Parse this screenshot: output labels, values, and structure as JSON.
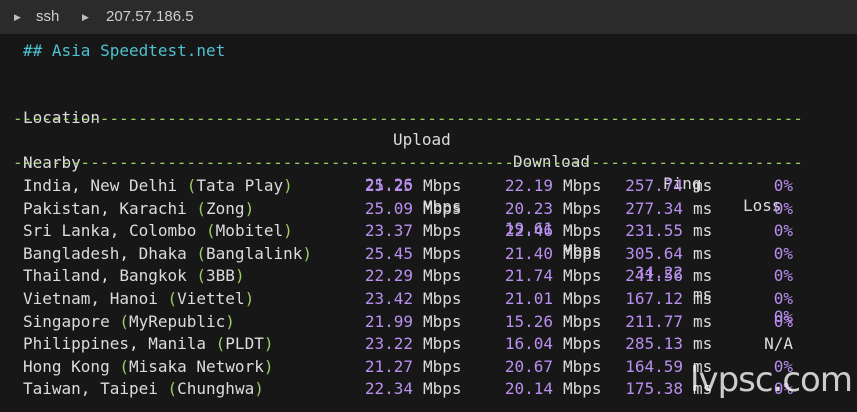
{
  "titlebar": {
    "tab_label": "ssh",
    "host": "207.57.186.5"
  },
  "terminal": {
    "heading": "## Asia Speedtest.net",
    "columns": {
      "location": "Location",
      "upload": "Upload",
      "download": "Download",
      "ping": "Ping",
      "loss": "Loss"
    },
    "separator": "-------------------------------------------------------------------------------------------",
    "nearby": {
      "location": "Nearby",
      "upload": "21.26",
      "download": "19.61",
      "ping": "34.22",
      "loss": "0%"
    },
    "units": {
      "speed": "Mbps",
      "ping": "ms"
    },
    "rows": [
      {
        "city": "India, New Delhi ",
        "open": "(",
        "isp": "Tata Play",
        "close": ")",
        "upload": "25.25",
        "download": "22.19",
        "ping": "257.74",
        "loss": "0%"
      },
      {
        "city": "Pakistan, Karachi ",
        "open": "(",
        "isp": "Zong",
        "close": ")",
        "upload": "25.09",
        "download": "20.23",
        "ping": "277.34",
        "loss": "0%"
      },
      {
        "city": "Sri Lanka, Colombo ",
        "open": "(",
        "isp": "Mobitel",
        "close": ")",
        "upload": "23.37",
        "download": "22.46",
        "ping": "231.55",
        "loss": "0%"
      },
      {
        "city": "Bangladesh, Dhaka ",
        "open": "(",
        "isp": "Banglalink",
        "close": ")",
        "upload": "25.45",
        "download": "21.40",
        "ping": "305.64",
        "loss": "0%"
      },
      {
        "city": "Thailand, Bangkok ",
        "open": "(",
        "isp": "3BB",
        "close": ")",
        "upload": "22.29",
        "download": "21.74",
        "ping": "241.56",
        "loss": "0%"
      },
      {
        "city": "Vietnam, Hanoi ",
        "open": "(",
        "isp": "Viettel",
        "close": ")",
        "upload": "23.42",
        "download": "21.01",
        "ping": "167.12",
        "loss": "0%"
      },
      {
        "city": "Singapore ",
        "open": "(",
        "isp": "MyRepublic",
        "close": ")",
        "upload": "21.99",
        "download": "15.26",
        "ping": "211.77",
        "loss": "0%"
      },
      {
        "city": "Philippines, Manila ",
        "open": "(",
        "isp": "PLDT",
        "close": ")",
        "upload": "23.22",
        "download": "16.04",
        "ping": "285.13",
        "loss": "N/A"
      },
      {
        "city": "Hong Kong ",
        "open": "(",
        "isp": "Misaka Network",
        "close": ")",
        "upload": "21.27",
        "download": "20.67",
        "ping": "164.59",
        "loss": "0%"
      },
      {
        "city": "Taiwan, Taipei ",
        "open": "(",
        "isp": "Chunghwa",
        "close": ")",
        "upload": "22.34",
        "download": "20.14",
        "ping": "175.38",
        "loss": "0%"
      }
    ]
  },
  "watermark": "lvpsc.com",
  "colors": {
    "background": "#171717",
    "titlebar": "#2b2b2b",
    "heading": "#4fc1d1",
    "separator": "#9ccc65",
    "paren": "#9ccc65",
    "value": "#ba8ff0",
    "text": "#dcdcdc"
  },
  "icons": [
    "chevron-right-icon"
  ]
}
